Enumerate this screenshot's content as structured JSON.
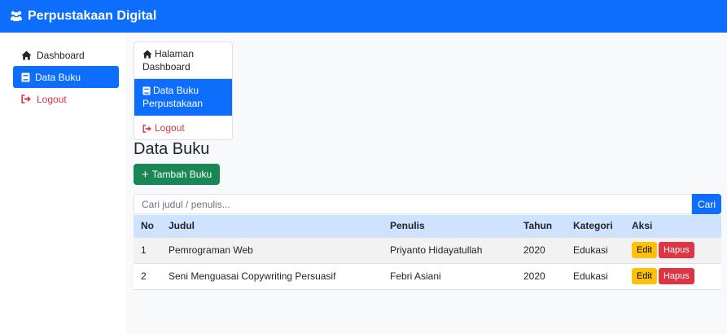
{
  "app": {
    "title": "Perpustakaan Digital"
  },
  "sidebar": {
    "items": [
      {
        "label": "Dashboard",
        "icon": "home-icon"
      },
      {
        "label": "Data Buku",
        "icon": "book-icon",
        "active": true
      },
      {
        "label": "Logout",
        "icon": "logout-icon"
      }
    ]
  },
  "listgroup": {
    "items": [
      {
        "label": "Halaman Dashboard",
        "icon": "home-icon"
      },
      {
        "label": "Data Buku Perpustakaan",
        "icon": "book-icon",
        "active": true
      },
      {
        "label": "Logout",
        "icon": "logout-icon"
      }
    ]
  },
  "page": {
    "title": "Data Buku",
    "add_button": "Tambah Buku"
  },
  "search": {
    "placeholder": "Cari judul / penulis...",
    "value": "",
    "button": "Cari"
  },
  "table": {
    "headers": [
      "No",
      "Judul",
      "Penulis",
      "Tahun",
      "Kategori",
      "Aksi"
    ],
    "rows": [
      {
        "no": "1",
        "judul": "Pemrograman Web",
        "penulis": "Priyanto Hidayatullah",
        "tahun": "2020",
        "kategori": "Edukasi",
        "edit": "Edit",
        "hapus": "Hapus"
      },
      {
        "no": "2",
        "judul": "Seni Menguasai Copywriting Persuasif",
        "penulis": "Febri Asiani",
        "tahun": "2020",
        "kategori": "Edukasi",
        "edit": "Edit",
        "hapus": "Hapus"
      }
    ]
  },
  "colors": {
    "primary": "#0d6efd",
    "success": "#198754",
    "warning": "#ffc107",
    "danger": "#dc3545",
    "table_header": "#cfe2ff"
  }
}
